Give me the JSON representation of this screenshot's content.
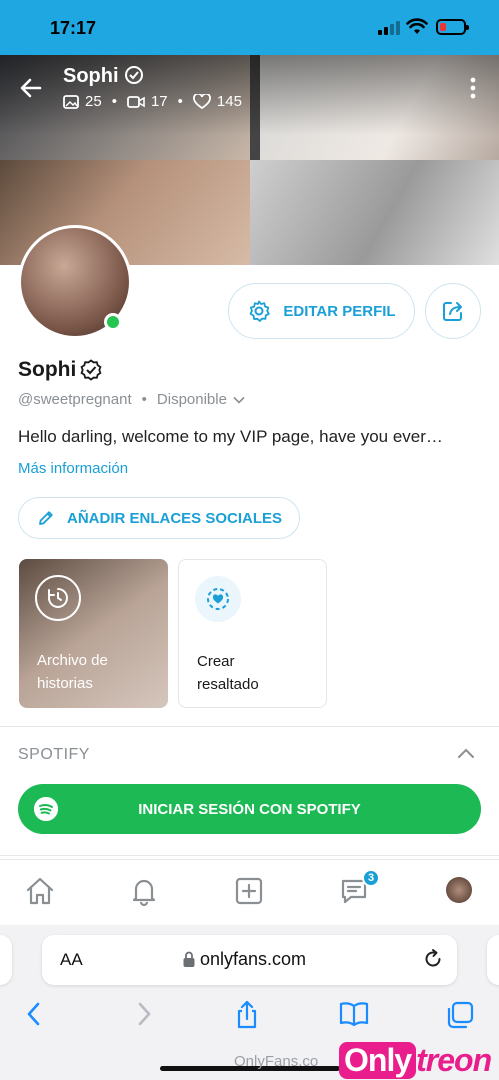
{
  "status_bar": {
    "time": "17:17"
  },
  "header": {
    "name": "Sophi",
    "photos_count": "25",
    "videos_count": "17",
    "likes_count": "145"
  },
  "profile": {
    "edit_label": "EDITAR PERFIL",
    "name": "Sophi",
    "handle": "@sweetpregnant",
    "availability": "Disponible",
    "bio": "Hello darling, welcome to my VIP page, have you ever…",
    "more_info": "Más información",
    "add_social_links": "AÑADIR ENLACES SOCIALES"
  },
  "highlights": [
    {
      "label_line1": "Archivo de",
      "label_line2": "historias"
    },
    {
      "label_line1": "Crear",
      "label_line2": "resaltado"
    }
  ],
  "spotify": {
    "title": "SPOTIFY",
    "button_label": "INICIAR SESIÓN CON SPOTIFY"
  },
  "tab_bar": {
    "messages_badge": "3"
  },
  "browser": {
    "text_size_label": "AA",
    "url": "onlyfans.com"
  },
  "watermark": {
    "text": "OnlyFans.co",
    "logo_part1": "Only",
    "logo_part2": "treon"
  },
  "colors": {
    "brand_blue": "#1a9fd6",
    "status_bar": "#1ea7e1",
    "spotify_green": "#1db954",
    "online_green": "#25c552"
  }
}
